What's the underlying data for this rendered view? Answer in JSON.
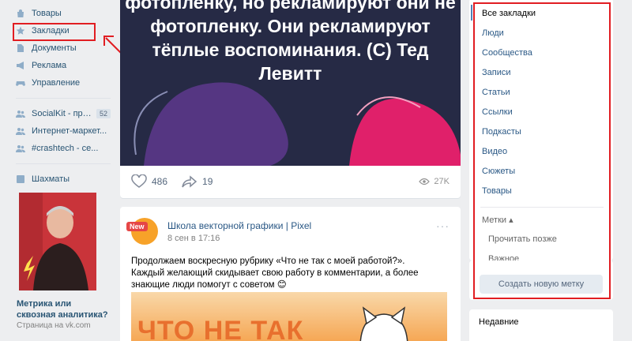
{
  "sidebar": {
    "items": [
      {
        "label": "Товары",
        "icon": "bag-icon"
      },
      {
        "label": "Закладки",
        "icon": "star-icon"
      },
      {
        "label": "Документы",
        "icon": "document-icon"
      },
      {
        "label": "Реклама",
        "icon": "megaphone-icon"
      },
      {
        "label": "Управление",
        "icon": "gamepad-icon"
      }
    ],
    "groups": [
      {
        "label": "SocialKit - про...",
        "count": "52",
        "icon": "people-icon"
      },
      {
        "label": "Интернет-маркет...",
        "icon": "people-icon"
      },
      {
        "label": "#crashtech - се...",
        "icon": "people-icon"
      }
    ],
    "apps": [
      {
        "label": "Шахматы",
        "icon": "chess-icon"
      }
    ],
    "ad": {
      "title": "Метрика или сквозная аналитика?",
      "subtitle": "Страница на vk.com"
    }
  },
  "feed": {
    "post1": {
      "quote": "фотопленку, но рекламируют они не фотопленку. Они рекламируют тёплые воспоминания. (С) Тед Левитт",
      "likes": "486",
      "shares": "19",
      "views": "27K"
    },
    "post2": {
      "badge": "New",
      "author": "Школа векторной графики | Pixel",
      "date": "8 сен в 17:16",
      "more": "···",
      "text": "Продолжаем воскресную рубрику «Что не так с моей работой?». Каждый желающий скидывает свою работу в комментарии, а более знающие люди помогут с советом 😊",
      "image_text": "ЧТО НЕ ТАК"
    }
  },
  "bookmarks_panel": {
    "items": [
      "Все закладки",
      "Люди",
      "Сообщества",
      "Записи",
      "Статьи",
      "Ссылки",
      "Подкасты",
      "Видео",
      "Сюжеты",
      "Товары"
    ],
    "tags_label": "Метки ▴",
    "tags": [
      "Прочитать позже",
      "Важное"
    ],
    "create_button": "Создать новую метку"
  },
  "recent": {
    "label": "Недавние"
  },
  "colors": {
    "highlight": "#e11d22",
    "link": "#2a5885",
    "accent": "#5181b8"
  }
}
